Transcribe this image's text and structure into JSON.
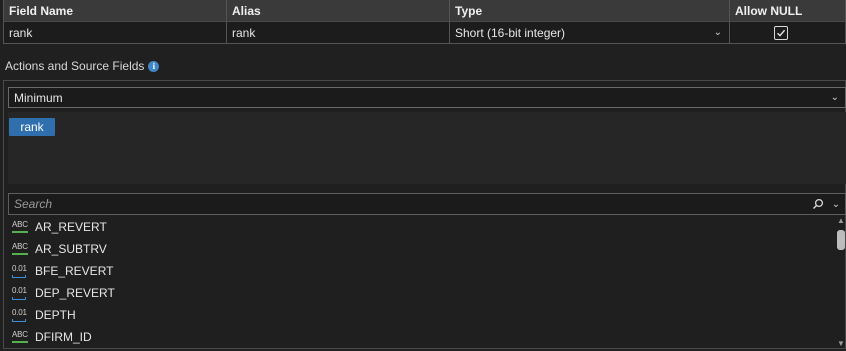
{
  "grid": {
    "headers": {
      "field_name": "Field Name",
      "alias": "Alias",
      "type": "Type",
      "allow_null": "Allow NULL"
    },
    "row": {
      "field_name": "rank",
      "alias": "rank",
      "type": "Short (16-bit integer)",
      "allow_null": true
    }
  },
  "section": {
    "label": "Actions and Source Fields",
    "info": "i"
  },
  "action": {
    "selected": "Minimum"
  },
  "source_fields": [
    "rank"
  ],
  "search": {
    "placeholder": "Search"
  },
  "fields": [
    {
      "name": "AR_REVERT",
      "kind": "text",
      "icon_text": "ABC"
    },
    {
      "name": "AR_SUBTRV",
      "kind": "text",
      "icon_text": "ABC"
    },
    {
      "name": "BFE_REVERT",
      "kind": "number",
      "icon_text": "0.01"
    },
    {
      "name": "DEP_REVERT",
      "kind": "number",
      "icon_text": "0.01"
    },
    {
      "name": "DEPTH",
      "kind": "number",
      "icon_text": "0.01"
    },
    {
      "name": "DFIRM_ID",
      "kind": "text",
      "icon_text": "ABC"
    }
  ],
  "colors": {
    "accent": "#2f6fad",
    "text_icon": "#57b04f",
    "number_icon": "#3d8fd9",
    "background": "#202020"
  }
}
